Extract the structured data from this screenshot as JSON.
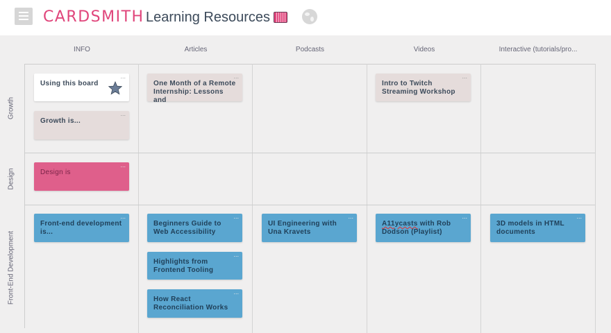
{
  "header": {
    "logo": "CARDSMITH",
    "board_title": "Learning Resources",
    "menu_icon": "hamburger-menu-icon",
    "board_icon": "board-thumbnail-icon",
    "globe_icon": "globe-icon"
  },
  "columns": [
    "INFO",
    "Articles",
    "Podcasts",
    "Videos",
    "Interactive (tutorials/pro..."
  ],
  "rows": [
    "Growth",
    "Design",
    "Front-End Development"
  ],
  "cards": {
    "using_board": "Using this board",
    "growth_is": "Growth is...",
    "remote_internship": "One Month of a Remote Internship: Lessons and",
    "twitch": "Intro to Twitch Streaming Workshop",
    "design_is": "Design is",
    "frontend_is": "Front-end development is...",
    "beginners_guide": "Beginners Guide to Web Accessibility",
    "highlights": "Highlights from Frontend Tooling",
    "react": "How React Reconciliation Works",
    "ui_engineering": "UI Engineering with Una Kravets",
    "a11y_prefix": "A11ycasts",
    "a11y_suffix": " with Rob Dodson (Playlist)",
    "models_3d": "3D models in HTML documents"
  },
  "card_menu_glyph": "...",
  "colors": {
    "brand": "#e0457b",
    "card_pink": "#df5f8b",
    "card_blue": "#5aa6d0",
    "card_beige": "#e5dcdb",
    "card_white": "#ffffff"
  }
}
